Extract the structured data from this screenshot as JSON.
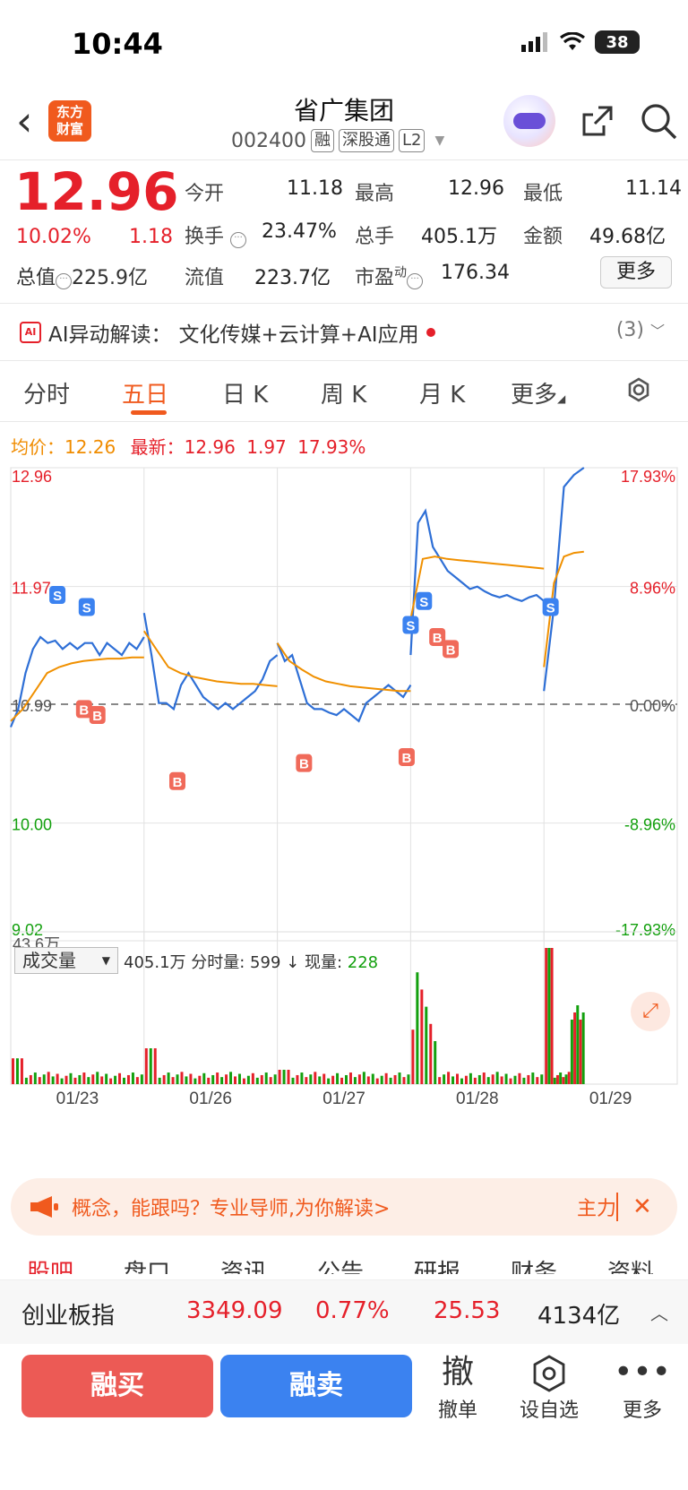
{
  "status": {
    "time": "10:44",
    "battery": "38"
  },
  "header": {
    "logo_line1": "东方",
    "logo_line2": "财富",
    "title": "省广集团",
    "code": "002400",
    "tags": [
      "融",
      "深股通",
      "L2"
    ]
  },
  "quote": {
    "price": "12.96",
    "change_pct": "10.02%",
    "change": "1.18",
    "open_label": "今开",
    "open": "11.18",
    "high_label": "最高",
    "high": "12.96",
    "low_label": "最低",
    "low": "11.14",
    "turnover_label": "换手",
    "turnover": "23.47%",
    "volume_label": "总手",
    "volume": "405.1万",
    "amount_label": "金额",
    "amount": "49.68亿",
    "mktcap_label": "总值",
    "mktcap": "225.9亿",
    "float_label": "流值",
    "float": "223.7亿",
    "pe_label": "市盈",
    "pe_sup": "动",
    "pe": "176.34",
    "more": "更多"
  },
  "ai": {
    "label": "AI异动解读：",
    "text": "文化传媒+云计算+AI应用",
    "count": "(3)"
  },
  "tabs": [
    "分时",
    "五日",
    "日 K",
    "周 K",
    "月 K",
    "更多"
  ],
  "legend": {
    "avg_label": "均价：",
    "avg": "12.26",
    "latest_label": "最新：",
    "latest": "12.96",
    "latest_chg": "1.97",
    "latest_pct": "17.93%"
  },
  "chart_data": {
    "type": "line",
    "y_ticks": [
      "12.96",
      "11.97",
      "10.99",
      "10.00",
      "9.02"
    ],
    "y_pct_ticks": [
      "17.93%",
      "8.96%",
      "0.00%",
      "-8.96%",
      "-17.93%"
    ],
    "x_labels": [
      "01/23",
      "01/26",
      "01/27",
      "01/28",
      "01/29"
    ],
    "ylim": [
      9.02,
      12.96
    ],
    "baseline": 10.99,
    "series": [
      {
        "name": "price",
        "color": "#2e6fd6",
        "days": [
          [
            10.8,
            10.95,
            11.25,
            11.45,
            11.55,
            11.5,
            11.52,
            11.45,
            11.5,
            11.45,
            11.5,
            11.5,
            11.4,
            11.5,
            11.45,
            11.4,
            11.5,
            11.45,
            11.55
          ],
          [
            11.75,
            11.4,
            11.0,
            11.0,
            10.95,
            11.15,
            11.25,
            11.15,
            11.05,
            11.0,
            10.95,
            11.0,
            10.95,
            11.0,
            11.05,
            11.1,
            11.2,
            11.35,
            11.4
          ],
          [
            11.5,
            11.35,
            11.4,
            11.2,
            11.0,
            10.95,
            10.95,
            10.92,
            10.9,
            10.95,
            10.9,
            10.85,
            11.0,
            11.05,
            11.1,
            11.15,
            11.1,
            11.05,
            11.15
          ],
          [
            11.4,
            12.5,
            12.6,
            12.3,
            12.2,
            12.1,
            12.05,
            12.0,
            11.95,
            11.97,
            11.93,
            11.9,
            11.88,
            11.9,
            11.87,
            11.85,
            11.88,
            11.9,
            11.85
          ],
          [
            11.1,
            11.8,
            12.8,
            12.9,
            12.96
          ]
        ]
      },
      {
        "name": "avg",
        "color": "#f09000",
        "days": [
          [
            10.85,
            10.95,
            11.1,
            11.25,
            11.3,
            11.33,
            11.35,
            11.36,
            11.37,
            11.37,
            11.38,
            11.38
          ],
          [
            11.6,
            11.45,
            11.3,
            11.25,
            11.22,
            11.2,
            11.18,
            11.17,
            11.16,
            11.16,
            11.15,
            11.14
          ],
          [
            11.5,
            11.35,
            11.28,
            11.22,
            11.18,
            11.16,
            11.14,
            11.13,
            11.12,
            11.11,
            11.1,
            11.1
          ],
          [
            11.7,
            12.2,
            12.22,
            12.2,
            12.19,
            12.18,
            12.17,
            12.16,
            12.15,
            12.14,
            12.13,
            12.12
          ],
          [
            11.3,
            12.0,
            12.22,
            12.25,
            12.26
          ]
        ]
      }
    ],
    "volume": {
      "label": "成交量",
      "max_label": "43.6万",
      "total": "405.1万",
      "tick_label": "分时量: 599",
      "now_label": "现量: ",
      "now": "228"
    }
  },
  "banner": {
    "text": "概念，能跟吗？专业导师,为你解读>",
    "right": "主力"
  },
  "info_tabs": [
    "股吧",
    "盘口",
    "资讯",
    "公告",
    "研报",
    "财务",
    "资料"
  ],
  "index": {
    "name": "创业板指",
    "value": "3349.09",
    "pct": "0.77%",
    "change": "25.53",
    "amount": "4134亿"
  },
  "bottom": {
    "buy": "融买",
    "sell": "融卖",
    "cancel_icon": "撤",
    "cancel": "撤单",
    "watch": "设自选",
    "more": "更多"
  }
}
